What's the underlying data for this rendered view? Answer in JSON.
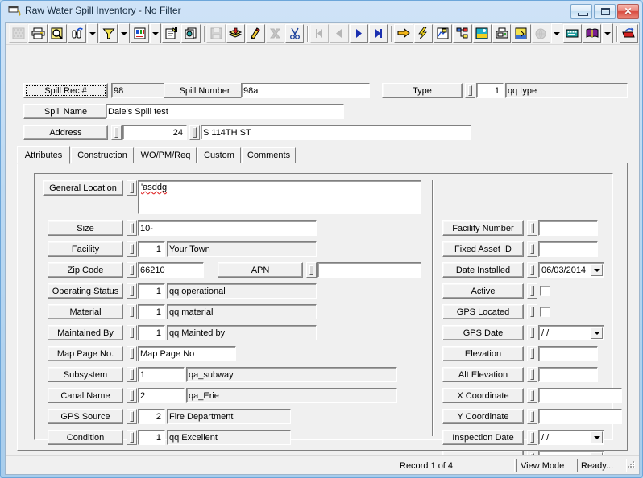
{
  "window": {
    "title": "Raw Water Spill Inventory - No Filter",
    "icon": "window-restore-icon",
    "buttons": {
      "minimize": "minimize-button",
      "maximize": "maximize-button",
      "close": "close-button"
    }
  },
  "toolbar": {
    "groups": [
      [
        {
          "name": "grid-view-icon",
          "label": "Grid View",
          "disabled": true
        },
        {
          "name": "print-icon",
          "label": "Print",
          "disabled": false
        },
        {
          "name": "print-preview-icon",
          "label": "Print Preview",
          "disabled": false
        },
        {
          "name": "find-icon",
          "label": "Find",
          "disabled": false,
          "dropdown": true
        },
        {
          "name": "filter-icon",
          "label": "Filter",
          "disabled": false,
          "dropdown": true
        },
        {
          "name": "report-icon",
          "label": "Report",
          "disabled": false,
          "dropdown": true
        },
        {
          "name": "properties-icon",
          "label": "Properties",
          "disabled": false
        },
        {
          "name": "copy-record-icon",
          "label": "Copy Record",
          "disabled": false
        }
      ],
      [
        {
          "name": "save-icon",
          "label": "Save",
          "disabled": true
        },
        {
          "name": "add-record-icon",
          "label": "Add Record",
          "disabled": false
        },
        {
          "name": "edit-record-icon",
          "label": "Edit Record",
          "disabled": false
        },
        {
          "name": "delete-record-icon",
          "label": "Delete Record",
          "disabled": true
        },
        {
          "name": "cut-icon",
          "label": "Cut",
          "disabled": false
        }
      ],
      [
        {
          "name": "first-record-icon",
          "label": "First Record",
          "disabled": true
        },
        {
          "name": "previous-record-icon",
          "label": "Previous Record",
          "disabled": true
        },
        {
          "name": "next-record-icon",
          "label": "Next Record",
          "disabled": false
        },
        {
          "name": "last-record-icon",
          "label": "Last Record",
          "disabled": false
        }
      ],
      [
        {
          "name": "goto-icon",
          "label": "Go To",
          "disabled": false
        },
        {
          "name": "lightning-icon",
          "label": "Quick Action",
          "disabled": false
        },
        {
          "name": "map-icon",
          "label": "Map",
          "disabled": false
        },
        {
          "name": "tree-view-icon",
          "label": "Tree View",
          "disabled": false
        },
        {
          "name": "image-icon",
          "label": "Image",
          "disabled": false
        },
        {
          "name": "fax-icon",
          "label": "Fax",
          "disabled": false
        },
        {
          "name": "gis-icon",
          "label": "GIS",
          "disabled": false
        },
        {
          "name": "globe-icon",
          "label": "Web",
          "disabled": true,
          "dropdown": true
        },
        {
          "name": "keyboard-icon",
          "label": "Keyboard",
          "disabled": false
        },
        {
          "name": "help-book-icon",
          "label": "Help",
          "disabled": false,
          "dropdown": true
        }
      ],
      [
        {
          "name": "exit-icon",
          "label": "Exit",
          "disabled": false
        }
      ]
    ]
  },
  "header": {
    "spill_rec": {
      "label": "Spill Rec #",
      "value": "98"
    },
    "spill_number": {
      "label": "Spill Number",
      "value": "98a"
    },
    "type": {
      "label": "Type",
      "code": "1",
      "value": "qq type"
    },
    "spill_name": {
      "label": "Spill Name",
      "value": "Dale's Spill test"
    },
    "address": {
      "label": "Address",
      "number": "24",
      "street": "S 114TH ST"
    }
  },
  "tabs": [
    {
      "label": "Attributes",
      "selected": true
    },
    {
      "label": "Construction",
      "selected": false
    },
    {
      "label": "WO/PM/Req",
      "selected": false
    },
    {
      "label": "Custom",
      "selected": false
    },
    {
      "label": "Comments",
      "selected": false
    }
  ],
  "attributes": {
    "left": [
      {
        "label": "General Location",
        "type": "memo",
        "value": "'asddg",
        "misspelled": true
      },
      {
        "label": "Size",
        "type": "text",
        "value": "10-"
      },
      {
        "label": "Facility",
        "type": "code-text",
        "code": "1",
        "value": "Your Town"
      },
      {
        "label": "Zip Code",
        "type": "text",
        "value": "66210"
      },
      {
        "label": "APN",
        "type": "text",
        "value": ""
      },
      {
        "label": "Operating Status",
        "type": "code-text",
        "code": "1",
        "value": "qq operational"
      },
      {
        "label": "Material",
        "type": "code-text",
        "code": "1",
        "value": "qq material"
      },
      {
        "label": "Maintained By",
        "type": "code-text",
        "code": "1",
        "value": "qq Mainted by"
      },
      {
        "label": "Map Page No.",
        "type": "text",
        "value": "Map Page No"
      },
      {
        "label": "Subsystem",
        "type": "code-text",
        "code": "1",
        "value": "qa_subway"
      },
      {
        "label": "Canal Name",
        "type": "code-text",
        "code": "2",
        "value": "qa_Erie"
      },
      {
        "label": "GPS Source",
        "type": "code-text",
        "code": "2",
        "value": "Fire Department"
      },
      {
        "label": "Condition",
        "type": "code-text",
        "code": "1",
        "value": "qq Excellent"
      }
    ],
    "right": [
      {
        "label": "Facility Number",
        "type": "text",
        "value": ""
      },
      {
        "label": "Fixed Asset ID",
        "type": "text",
        "value": ""
      },
      {
        "label": "Date Installed",
        "type": "date",
        "value": "06/03/2014"
      },
      {
        "label": "Active",
        "type": "checkbox",
        "checked": false
      },
      {
        "label": "GPS Located",
        "type": "checkbox",
        "checked": false
      },
      {
        "label": "GPS Date",
        "type": "date",
        "value": "  /  /"
      },
      {
        "label": "Elevation",
        "type": "text",
        "value": ""
      },
      {
        "label": "Alt Elevation",
        "type": "text",
        "value": ""
      },
      {
        "label": "X Coordinate",
        "type": "text",
        "value": ""
      },
      {
        "label": "Y Coordinate",
        "type": "text",
        "value": ""
      },
      {
        "label": "Inspection Date",
        "type": "date",
        "value": "  /  /"
      },
      {
        "label": "Next Insp Date",
        "type": "date",
        "value": "  /  /"
      }
    ]
  },
  "statusbar": {
    "record": "Record 1 of 4",
    "mode": "View Mode",
    "state": "Ready..."
  }
}
